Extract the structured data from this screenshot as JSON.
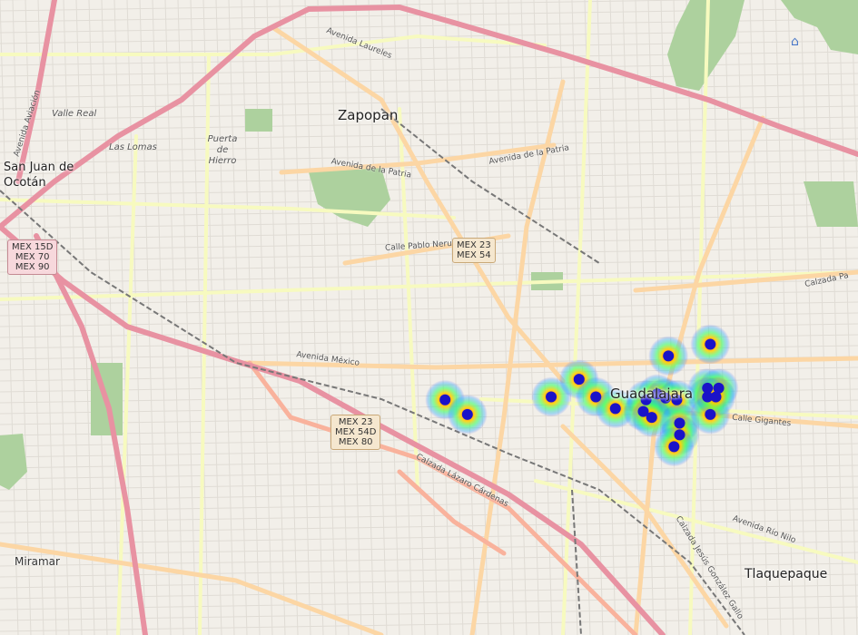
{
  "map": {
    "places": {
      "zapopan": "Zapopan",
      "guadalajara": "Guadalajara",
      "tlaquepaque": "Tlaquepaque",
      "miramar": "Miramar",
      "san_juan": "San Juan de Ocotán",
      "valle_real": "Valle Real",
      "las_lomas": "Las Lomas",
      "puerta_de_hierro": "Puerta de Hierro"
    },
    "roads": {
      "laureles": "Avenida Laureles",
      "patria_1": "Avenida de la Patria",
      "patria_2": "Avenida de la Patria",
      "pablo_neruda": "Calle Pablo Neruda",
      "mexico": "Avenida México",
      "lazaro": "Calzada Lázaro Cárdenas",
      "gigantes": "Calle Gigantes",
      "rio_nilo": "Avenida Río Nilo",
      "gonzalez_gallo": "Calzada Jesús González Gallo",
      "calzada_pa": "Calzada Pa",
      "aviacion": "Avenida Aviación"
    },
    "shields": {
      "mex15d": "MEX 15D\nMEX 70\nMEX 90",
      "mex23_top": "MEX 23\nMEX 54",
      "mex23_bottom": "MEX 23\nMEX 54D\nMEX 80"
    },
    "heatmap_points": [
      {
        "lat": 20.6795,
        "lon": -103.388
      },
      {
        "lat": 20.677,
        "lon": -103.384
      },
      {
        "lat": 20.68,
        "lon": -103.369
      },
      {
        "lat": 20.683,
        "lon": -103.364
      },
      {
        "lat": 20.68,
        "lon": -103.361
      },
      {
        "lat": 20.678,
        "lon": -103.3575
      },
      {
        "lat": 20.6795,
        "lon": -103.352
      },
      {
        "lat": 20.6805,
        "lon": -103.35
      },
      {
        "lat": 20.6798,
        "lon": -103.3485
      },
      {
        "lat": 20.6795,
        "lon": -103.3465
      },
      {
        "lat": 20.6775,
        "lon": -103.3525
      },
      {
        "lat": 20.6765,
        "lon": -103.351
      },
      {
        "lat": 20.6755,
        "lon": -103.346
      },
      {
        "lat": 20.6735,
        "lon": -103.346
      },
      {
        "lat": 20.6715,
        "lon": -103.347
      },
      {
        "lat": 20.687,
        "lon": -103.348
      },
      {
        "lat": 20.689,
        "lon": -103.3405
      },
      {
        "lat": 20.6815,
        "lon": -103.341
      },
      {
        "lat": 20.6815,
        "lon": -103.339
      },
      {
        "lat": 20.68,
        "lon": -103.341
      },
      {
        "lat": 20.677,
        "lon": -103.3405
      },
      {
        "lat": 20.68,
        "lon": -103.3395
      }
    ],
    "colors": {
      "background": "#f2efe9",
      "motorway": "#e892a2",
      "trunk": "#f9b29c",
      "primary": "#fcd6a4",
      "secondary": "#f7fabf",
      "park": "#add19e",
      "railway": "#777777",
      "heat_low": "#00c8ff",
      "heat_high": "#ff0000",
      "marker": "#1a12c8"
    }
  }
}
